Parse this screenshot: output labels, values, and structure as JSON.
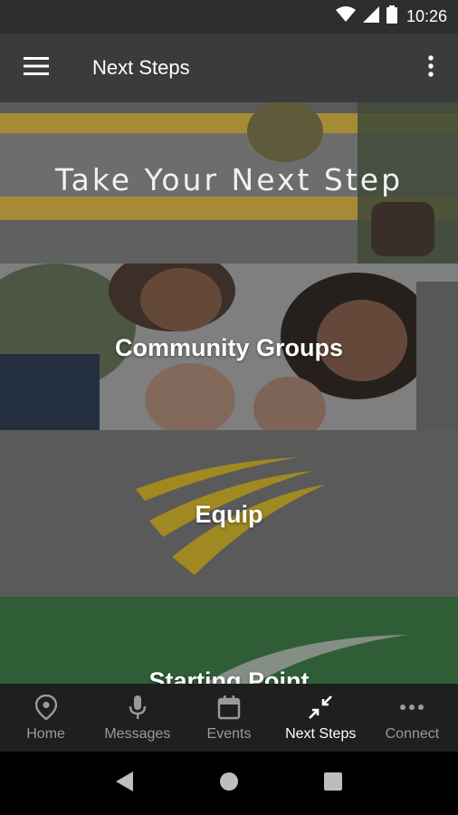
{
  "status_bar": {
    "time": "10:26",
    "icons": [
      "wifi-icon",
      "signal-icon",
      "battery-icon"
    ]
  },
  "app_bar": {
    "title": "Next Steps",
    "menu_icon": "hamburger-icon",
    "overflow_icon": "more-vert-icon"
  },
  "hero": {
    "title": "Take Your Next Step"
  },
  "cards": [
    {
      "label": "Community Groups"
    },
    {
      "label": "Equip"
    },
    {
      "label": "Starting Point"
    }
  ],
  "bottom_nav": {
    "items": [
      {
        "label": "Home",
        "icon": "location-pin-icon",
        "active": false
      },
      {
        "label": "Messages",
        "icon": "microphone-icon",
        "active": false
      },
      {
        "label": "Events",
        "icon": "calendar-icon",
        "active": false
      },
      {
        "label": "Next Steps",
        "icon": "arrows-inward-icon",
        "active": true
      },
      {
        "label": "Connect",
        "icon": "more-horiz-icon",
        "active": false
      }
    ]
  },
  "colors": {
    "app_bar": "#3b3b3b",
    "status_bar": "#2e2e2e",
    "bottom_nav": "#1f1f1f",
    "equip_gold": "#c8a820",
    "starting_green": "#2f5e36",
    "hero_yellow": "#c9a43a"
  }
}
